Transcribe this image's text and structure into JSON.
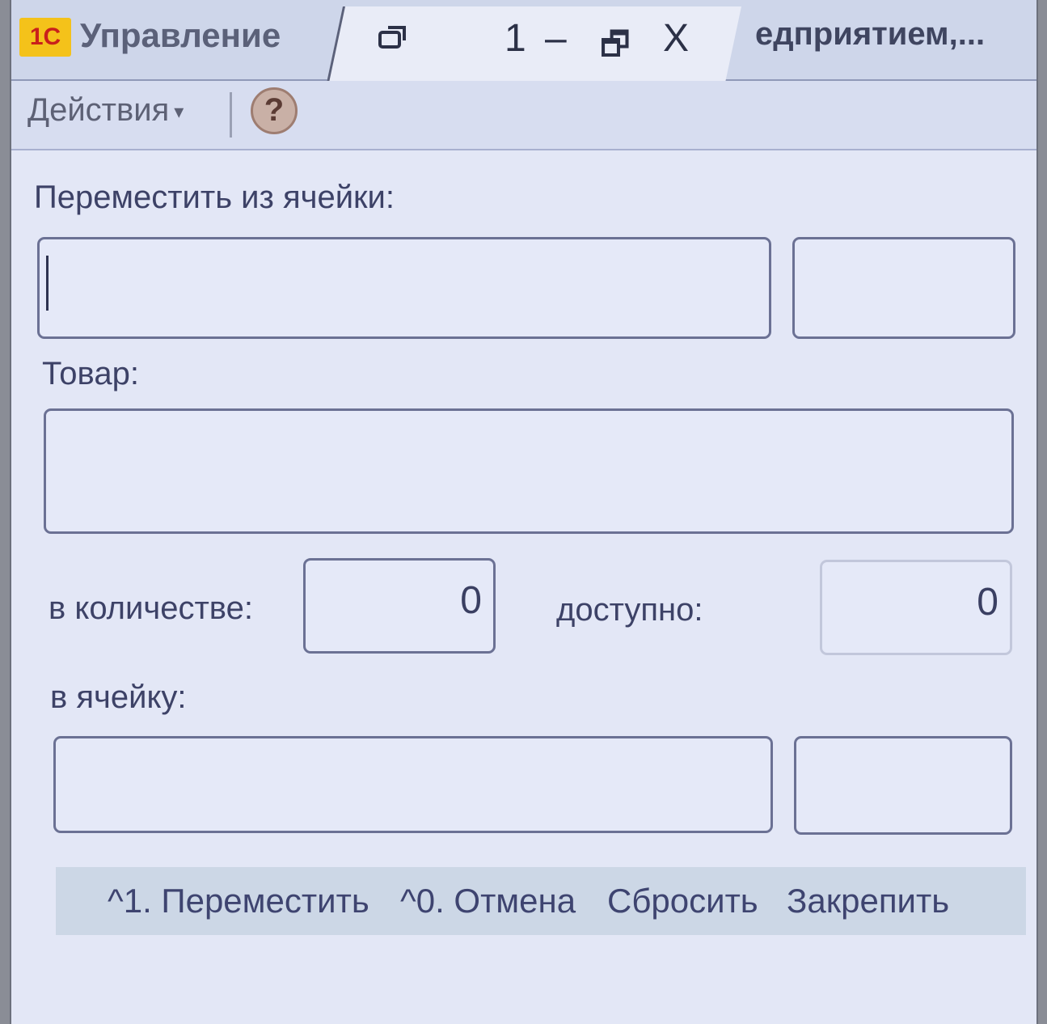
{
  "titlebar": {
    "logo": "1С",
    "app_title": "Управление",
    "window_number": "1",
    "minimize_glyph": "–",
    "restore_glyph": "🗗",
    "close_glyph": "X",
    "right_title": "едприятием,..."
  },
  "toolbar": {
    "actions_label": "Действия",
    "actions_arrow": "▾",
    "help_label": "?"
  },
  "form": {
    "from_cell_label": "Переместить из ячейки:",
    "from_cell_value": "",
    "from_cell_extra_value": "",
    "product_label": "Товар:",
    "product_value": "",
    "quantity_label": "в количестве:",
    "quantity_value": "0",
    "available_label": "доступно:",
    "available_value": "0",
    "to_cell_label": "в ячейку:",
    "to_cell_value": "",
    "to_cell_extra_value": ""
  },
  "commands": {
    "move": "^1. Переместить",
    "cancel": "^0. Отмена",
    "reset": "Сбросить",
    "pin": "Закрепить"
  },
  "icons": {
    "app_logo": "1c-logo-icon",
    "window_icon": "window-icon",
    "help": "help-icon",
    "dropdown": "chevron-down-icon"
  }
}
